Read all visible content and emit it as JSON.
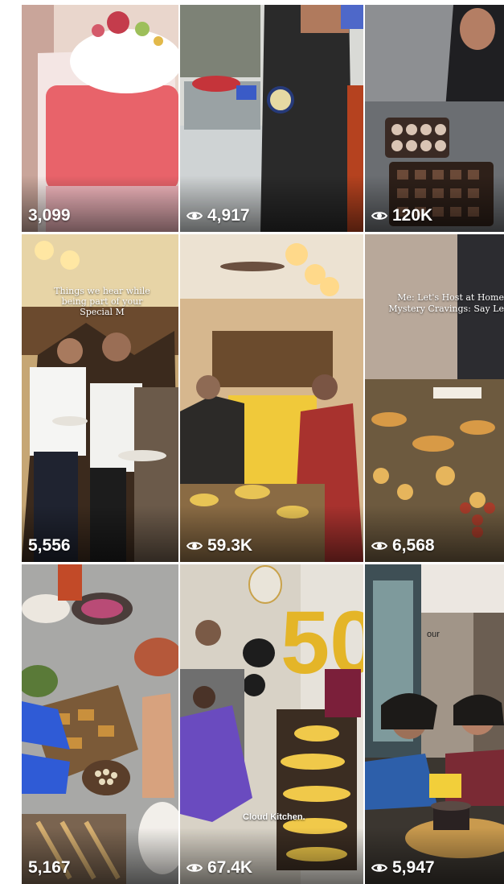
{
  "reels": [
    {
      "views": "3,099",
      "eye": false
    },
    {
      "views": "4,917",
      "eye": true
    },
    {
      "views": "120K",
      "eye": true
    },
    {
      "views": "5,556",
      "eye": false
    },
    {
      "views": "59.3K",
      "eye": true
    },
    {
      "views": "6,568",
      "eye": true
    },
    {
      "views": "5,167",
      "eye": false
    },
    {
      "views": "67.4K",
      "eye": true
    },
    {
      "views": "5,947",
      "eye": true
    }
  ],
  "overlays": {
    "tile4_caption": "Things we hear while being part of your Special M",
    "tile6_caption_1": "Me: Let's Host at Home",
    "tile6_caption_2": "Mystery Cravings: Say Le",
    "tile8_balloon": "50",
    "tile8_label": "Cloud Kitchen.",
    "tile9_sign": "our"
  }
}
